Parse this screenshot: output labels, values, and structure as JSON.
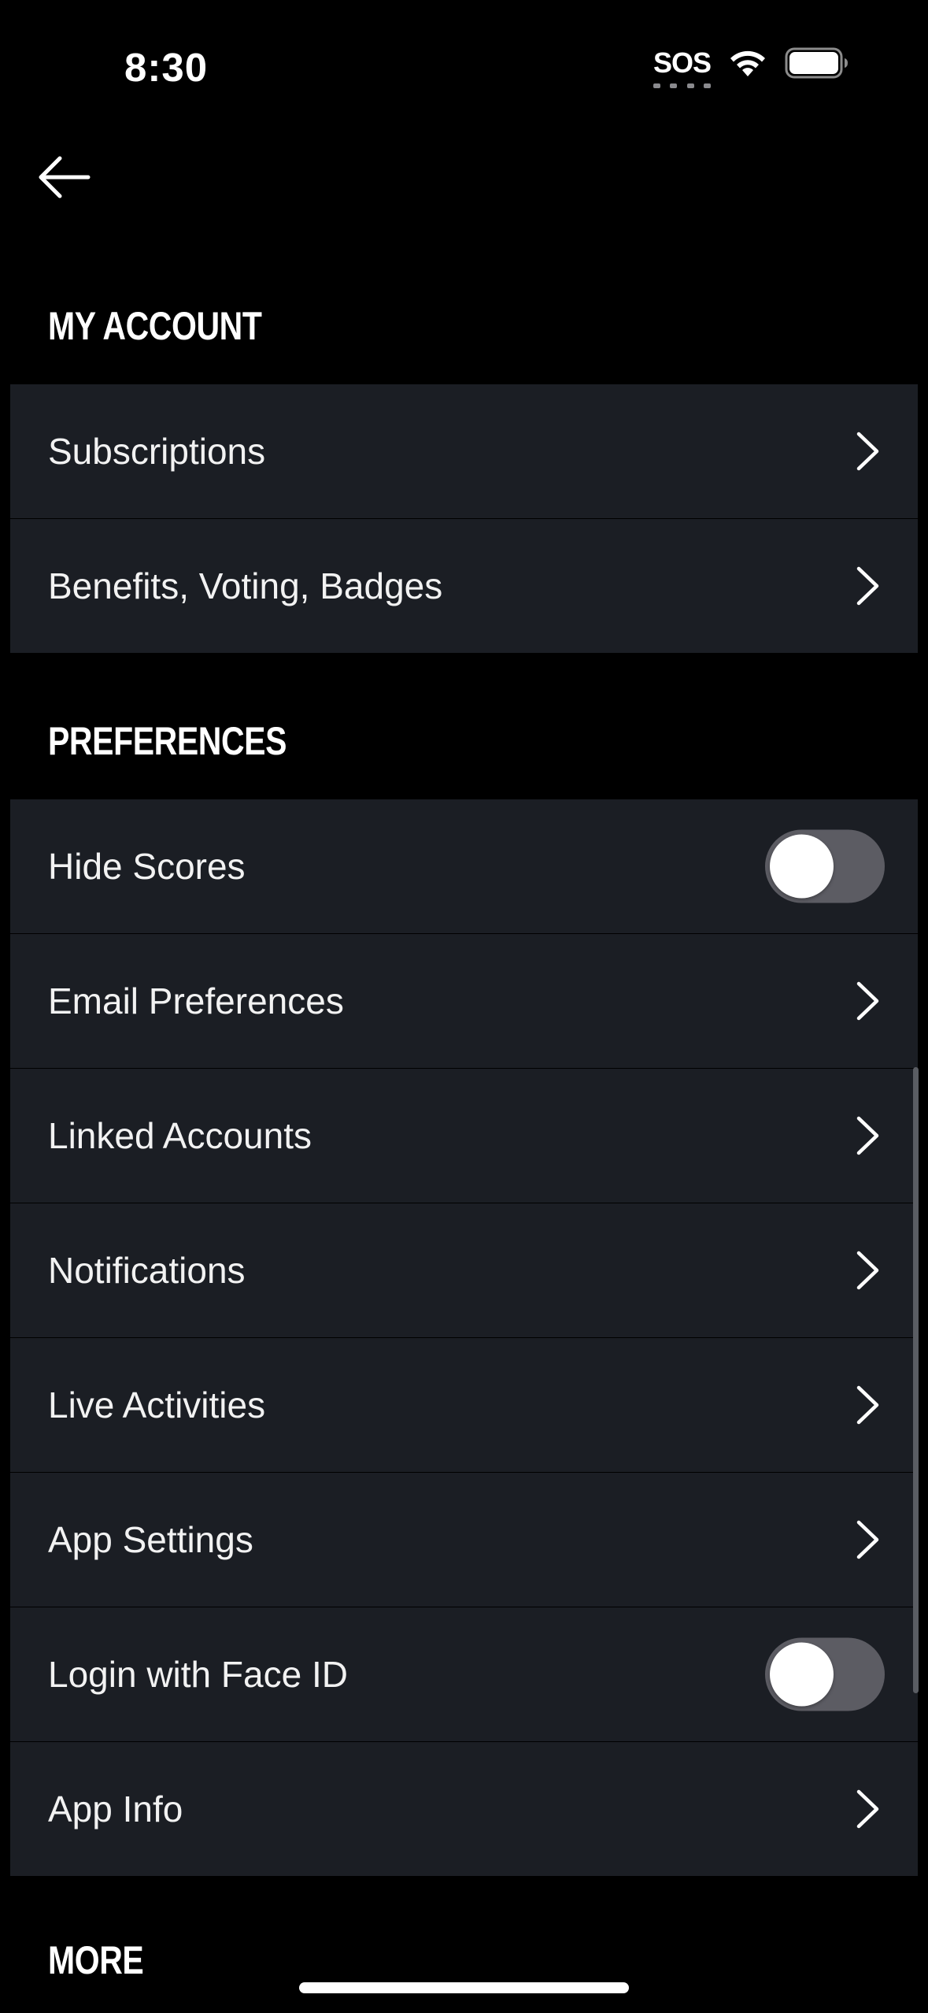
{
  "status_bar": {
    "time": "8:30",
    "sos": "SOS",
    "wifi_icon": "wifi-icon",
    "battery_icon": "battery-icon"
  },
  "navigation": {
    "back_icon": "back-arrow-icon"
  },
  "sections": {
    "my_account": {
      "title": "MY ACCOUNT",
      "items": [
        {
          "label": "Subscriptions",
          "type": "link"
        },
        {
          "label": "Benefits, Voting, Badges",
          "type": "link"
        }
      ]
    },
    "preferences": {
      "title": "PREFERENCES",
      "items": [
        {
          "label": "Hide Scores",
          "type": "toggle",
          "on": false
        },
        {
          "label": "Email Preferences",
          "type": "link"
        },
        {
          "label": "Linked Accounts",
          "type": "link"
        },
        {
          "label": "Notifications",
          "type": "link"
        },
        {
          "label": "Live Activities",
          "type": "link"
        },
        {
          "label": "App Settings",
          "type": "link"
        },
        {
          "label": "Login with Face ID",
          "type": "toggle",
          "on": false
        },
        {
          "label": "App Info",
          "type": "link"
        }
      ]
    },
    "more": {
      "title": "MORE"
    }
  },
  "colors": {
    "background": "#000000",
    "row_background": "#1b1e24",
    "toggle_off_track": "#5c5c63",
    "text": "#ffffff"
  }
}
